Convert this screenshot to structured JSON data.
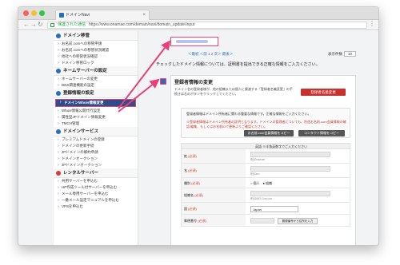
{
  "browser": {
    "tab_title": "ドメインNavi",
    "secure_label": "保護された通信",
    "url": "https://www.onamae.com/domain/navi/domain_update/input"
  },
  "sidebar": {
    "sections": [
      {
        "title": "ドメイン移管",
        "items": [
          "お名前.comへの移管申請",
          "お名前.comへの移管状況確認",
          "他社への移管状況確認",
          "ドメイン移管ロック"
        ]
      },
      {
        "title": "ネームサーバーの設定",
        "items": [
          "ネームサーバーの変更",
          "DNS関連機能の設定"
        ]
      },
      {
        "title": "登録情報の設定",
        "items": [
          "ドメインWhois情報変更",
          "Whois情報公開代行設定",
          "属性型JPドメイン情報変更",
          "TMCH管理"
        ]
      },
      {
        "title": "ドメインサービス",
        "items": [
          "プレミアムドメインの登録",
          "ドメインの更新手続",
          "JPドメインの解約申請",
          "ドメインオークション",
          "JPドメインオークション"
        ]
      },
      {
        "title": "レンタルサーバー",
        "items": [
          "共用サーバーを申込む",
          "HP作成ツール付サーバーを申込む",
          "メール専用サーバーを申込む",
          "一番メール設定マニュアルを申込む",
          "VPSを申込む"
        ]
      }
    ],
    "selected_item": "ドメインWhois情報変更"
  },
  "main": {
    "pager": "＜最初 ＜前 1 2 次＞ 最後＞",
    "perpage_label": "表示件数",
    "perpage_value": "10",
    "info_line": "チェックしたドメイン情報については、証明書を提出できる正確な情報をご入力ください。",
    "panel": {
      "title": "登録者情報の変更",
      "desc": "ドメイン名の登録者様が、他の組織または個人に譲渡する「登録者名義変更」の手続きは右のボタンをクリックしてください。",
      "change_button": "登録者名義変更",
      "notice_text": "登録者情報はドメイン所有者に関わる重要な情報です。正確な情報をご入力ください。",
      "notice_red": "※登録者情報はドメイン所有者の証明となります。ドメインの管理者についても、別途お名前.com会員情報の確認/編集、もしくはお名前IDで更新よりご確認ください。",
      "copy_member_button": "お名前.com会員情報をコピー",
      "copy_contact_button": "コンタクト情報をコピー"
    },
    "form": {
      "header": "英語 ※半角英数字でご入力ください",
      "rows": [
        {
          "label": "姓",
          "required": "(必須)",
          "hint": "例)Onamae"
        },
        {
          "label": "名",
          "required": "(必須)",
          "hint": "例)Taro"
        },
        {
          "label": "種別",
          "required": "(必須)",
          "radio": "○ 個人　● 組織"
        },
        {
          "label": "組織名",
          "required": "(必須)",
          "hint": "例)GMO Corp,Inc"
        },
        {
          "label": "国",
          "required": "(必須)",
          "select": "Japan"
        },
        {
          "label": "郵便番号",
          "required": "(必須)",
          "button": "郵便番号から住所を入力"
        }
      ]
    }
  }
}
